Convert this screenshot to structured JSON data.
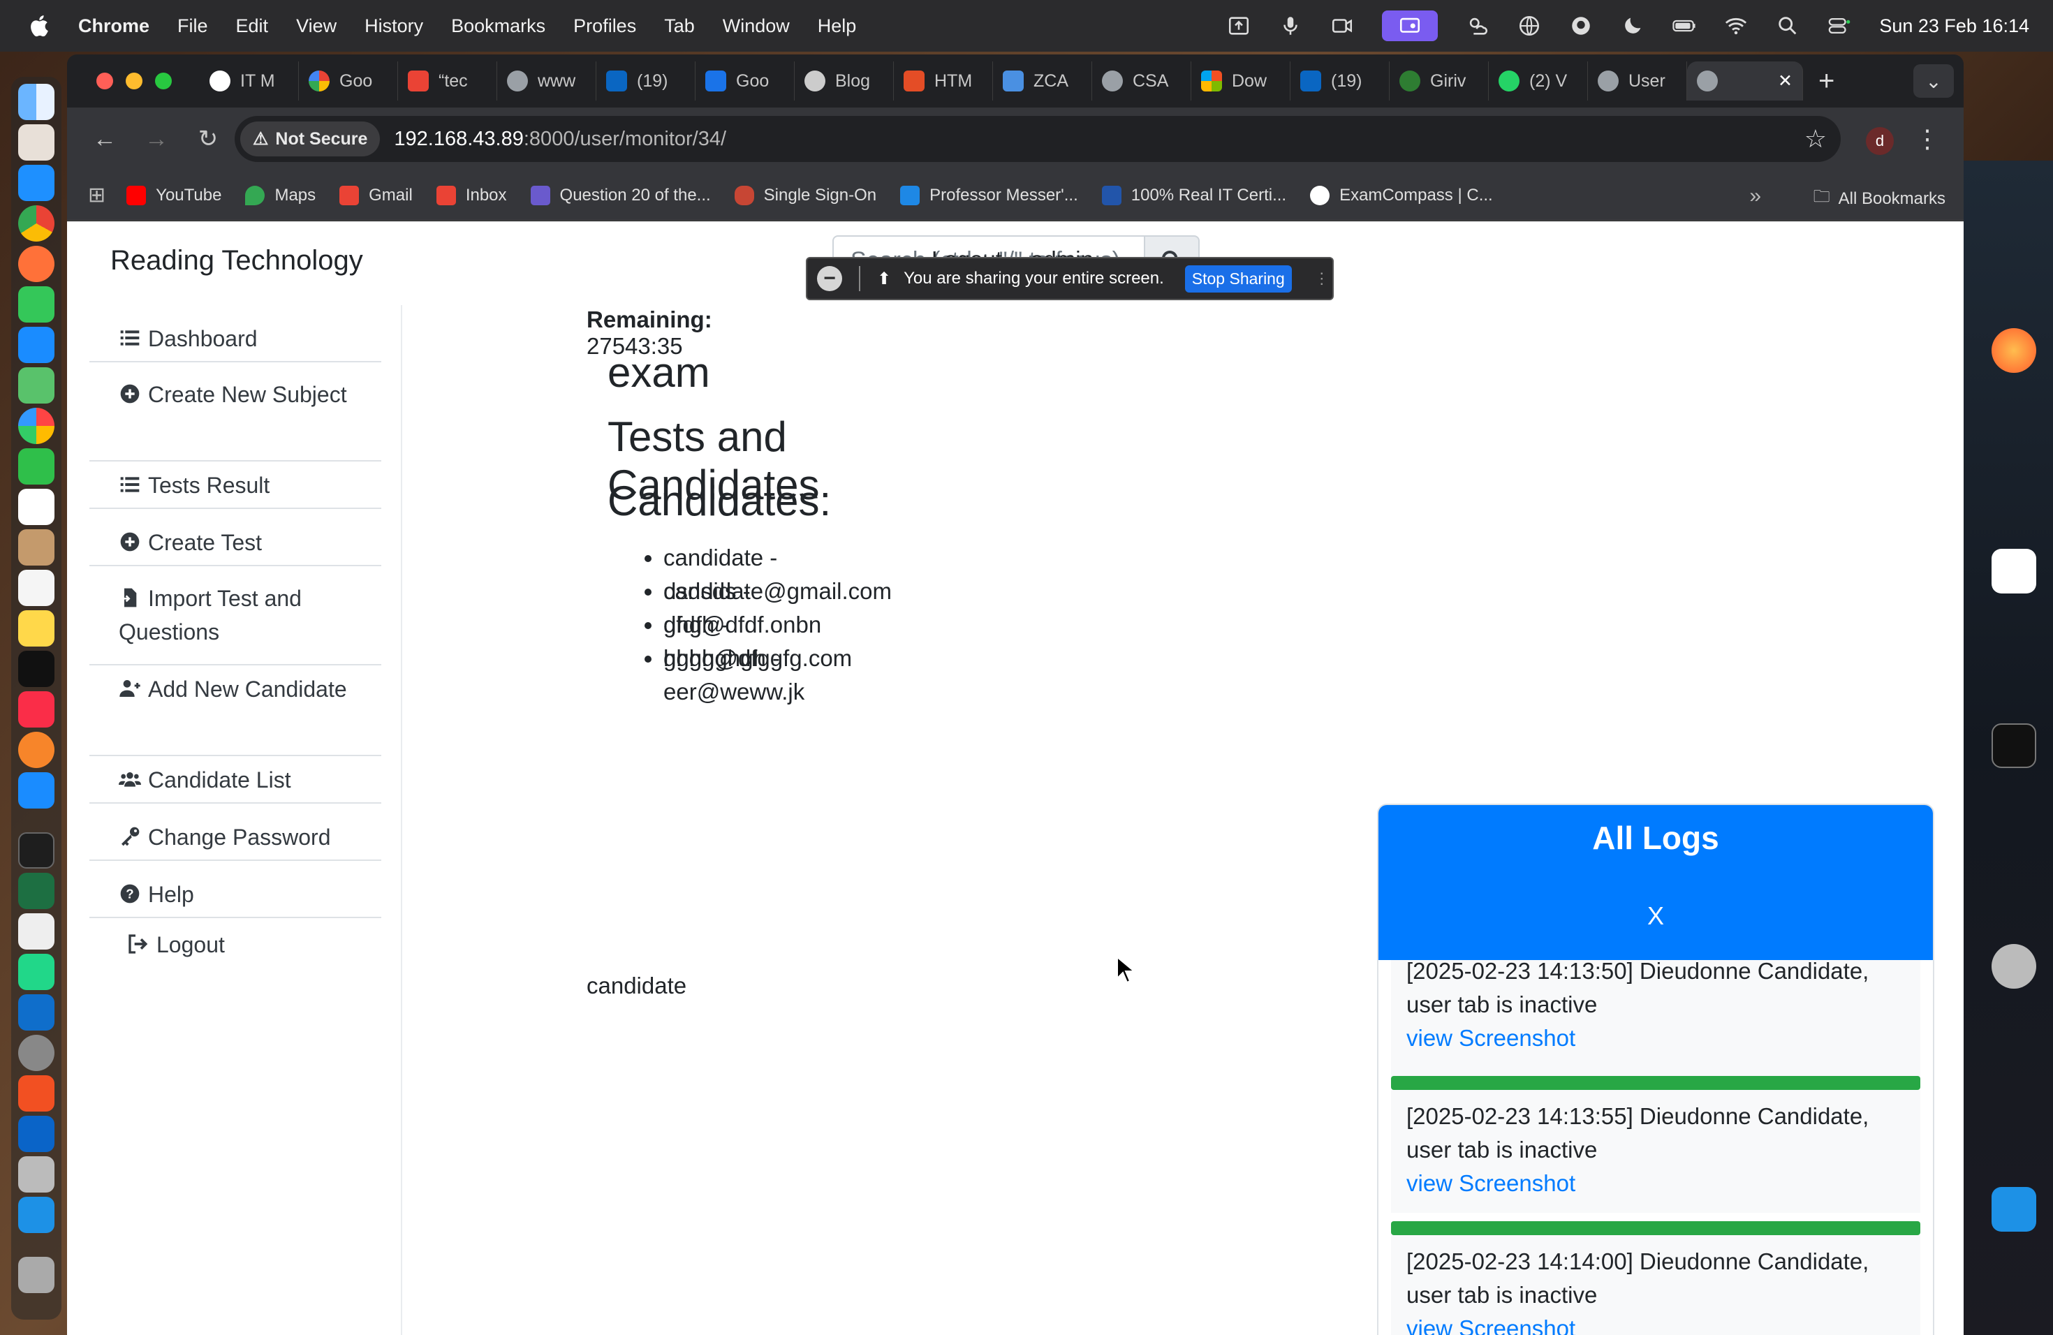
{
  "menubar": {
    "app": "Chrome",
    "items": [
      "File",
      "Edit",
      "View",
      "History",
      "Bookmarks",
      "Profiles",
      "Tab",
      "Window",
      "Help"
    ],
    "clock": "Sun 23 Feb  16:14"
  },
  "tabs": [
    {
      "label": "IT M",
      "color": "#ffffff"
    },
    {
      "label": "Goo",
      "color": "#4285f4"
    },
    {
      "label": "“tec",
      "color": "#ea4335"
    },
    {
      "label": "www",
      "color": "#9aa0a6"
    },
    {
      "label": "(19)",
      "color": "#0a66c2"
    },
    {
      "label": "Goo",
      "color": "#1a73e8"
    },
    {
      "label": "Blog",
      "color": "#cccccc"
    },
    {
      "label": "HTM",
      "color": "#e44d26"
    },
    {
      "label": "ZCA",
      "color": "#4a90e2"
    },
    {
      "label": "CSA",
      "color": "#9aa0a6"
    },
    {
      "label": "Dow",
      "color": "#f25022"
    },
    {
      "label": "(19)",
      "color": "#0a66c2"
    },
    {
      "label": "Giriv",
      "color": "#2e7d32"
    },
    {
      "label": "(2) V",
      "color": "#25d366"
    },
    {
      "label": "User",
      "color": "#9aa0a6"
    }
  ],
  "active_tab": {
    "close": "✕"
  },
  "omnibox": {
    "security": "Not Secure",
    "host": "192.168.43.89",
    "path": ":8000/user/monitor/34/"
  },
  "profile_initial": "d",
  "bookmarks": [
    {
      "label": "YouTube",
      "color": "#ff0000"
    },
    {
      "label": "Maps",
      "color": "#34a853"
    },
    {
      "label": "Gmail",
      "color": "#ea4335"
    },
    {
      "label": "Inbox",
      "color": "#ea4335"
    },
    {
      "label": "Question 20 of the...",
      "color": "#6a5acd"
    },
    {
      "label": "Single Sign-On",
      "color": "#c74634"
    },
    {
      "label": "Professor Messer'...",
      "color": "#1e88e5"
    },
    {
      "label": "100% Real IT Certi...",
      "color": "#2255aa"
    },
    {
      "label": "ExamCompass | C...",
      "color": "#ffffff"
    }
  ],
  "bookmarks_more": "»",
  "all_bookmarks": "All Bookmarks",
  "share_banner": {
    "text": "You are sharing your entire screen.",
    "stop_label": "Stop Sharing"
  },
  "site": {
    "brand": "Reading Technology",
    "search_placeholder": "Search (ctrl + \"/\" to focus)",
    "nav_logout": "Logout",
    "nav_user": "admin"
  },
  "sidebar": {
    "items": [
      {
        "label": "Dashboard",
        "icon": "list-icon"
      },
      {
        "label": "Create New Subject",
        "icon": "plus-circle-icon"
      },
      {
        "label": "Tests Result",
        "icon": "list-icon"
      },
      {
        "label": "Create Test",
        "icon": "plus-circle-icon"
      },
      {
        "label": "Import Test and Questions",
        "icon": "file-import-icon"
      },
      {
        "label": "Add New Candidate",
        "icon": "user-plus-icon"
      },
      {
        "label": "Candidate List",
        "icon": "users-icon"
      },
      {
        "label": "Change Password",
        "icon": "key-icon"
      },
      {
        "label": "Help",
        "icon": "question-circle-icon"
      },
      {
        "label": "Logout",
        "icon": "sign-out-icon"
      }
    ]
  },
  "main": {
    "time_remaining_label": "Time Remaining:",
    "time_remaining_value": "27543:35",
    "exam_title": "exam",
    "tests_heading": "Tests and Candidates",
    "candidates_heading": "Candidates:",
    "candidates": [
      "candidate - candidate@gmail.com",
      "dsdsds - dfdf@dfdf.onbn",
      "ghgh - hghg@dfggfg.com",
      "ghghghgh - eer@weww.jk"
    ],
    "selected_candidate": "candidate"
  },
  "logs": {
    "title": "All Logs",
    "close": "X",
    "entries": [
      {
        "line1": "[2025-02-23 14:13:50] Dieudonne Candidate,",
        "line2": "user tab is inactive",
        "link": "view Screenshot"
      },
      {
        "line1": "[2025-02-23 14:13:55] Dieudonne Candidate,",
        "line2": "user tab is inactive",
        "link": "view Screenshot"
      },
      {
        "line1": "[2025-02-23 14:14:00] Dieudonne Candidate,",
        "line2": "user tab is inactive",
        "link": "view Screenshot"
      }
    ]
  }
}
